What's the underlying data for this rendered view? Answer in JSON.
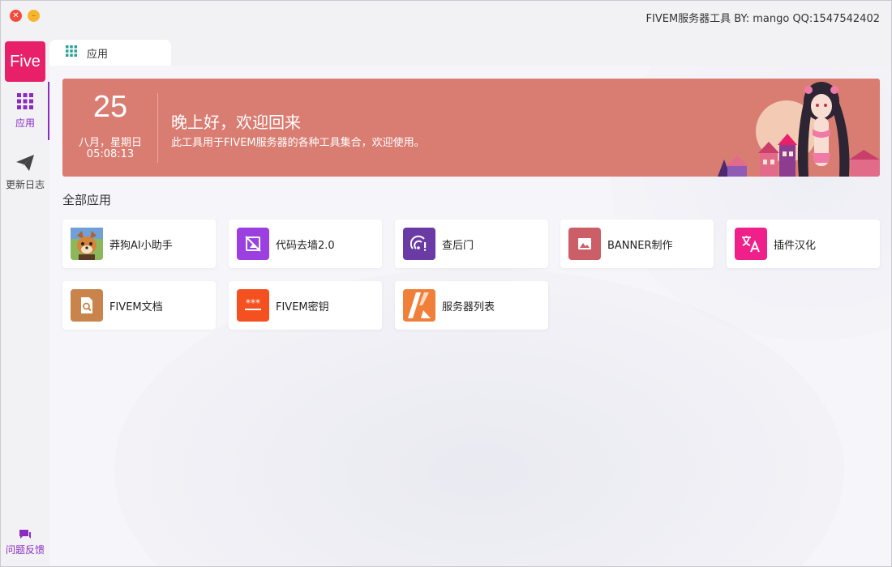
{
  "window": {
    "title": "FIVEM服务器工具 BY: mango QQ:1547542402"
  },
  "sidebar": {
    "logo_text": "Five",
    "items": [
      {
        "label": "应用",
        "icon": "grid-icon",
        "active": true
      },
      {
        "label": "更新日志",
        "icon": "paper-plane-icon",
        "active": false
      }
    ],
    "feedback_label": "问题反馈"
  },
  "tabs": [
    {
      "label": "应用",
      "icon": "grid-icon"
    }
  ],
  "banner": {
    "day": "25",
    "week": "八月，星期日",
    "time": "05:08:13",
    "greeting": "晚上好，欢迎回来",
    "subtitle": "此工具用于FIVEM服务器的各种工具集合，欢迎使用。"
  },
  "section": {
    "title": "全部应用"
  },
  "apps": [
    {
      "label": "莽狗AI小助手",
      "icon": "dog-avatar-icon",
      "color": "#6a9a3a"
    },
    {
      "label": "代码去墙2.0",
      "icon": "no-image-icon",
      "color": "#9b3fe0"
    },
    {
      "label": "查后门",
      "icon": "signal-alert-icon",
      "color": "#6a3aa5"
    },
    {
      "label": "BANNER制作",
      "icon": "image-icon",
      "color": "#cc5e68"
    },
    {
      "label": "插件汉化",
      "icon": "translate-icon",
      "color": "#f0208a"
    },
    {
      "label": "FIVEM文档",
      "icon": "document-search-icon",
      "color": "#c8844a"
    },
    {
      "label": "FIVEM密钥",
      "icon": "password-icon",
      "color": "#f5501f"
    },
    {
      "label": "服务器列表",
      "icon": "fivem-logo-icon",
      "color": "#f07f3a"
    }
  ],
  "colors": {
    "accent": "#8a2cc4",
    "logo_bg": "#e8206a",
    "banner_bg": "#d97d72"
  }
}
